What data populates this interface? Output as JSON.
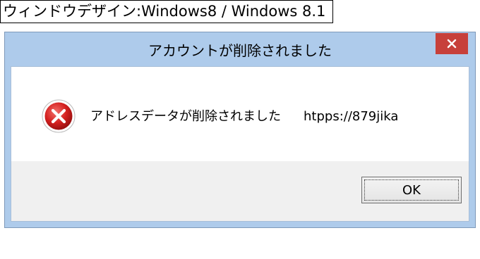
{
  "caption": "ウィンドウデザイン:Windows8 / Windows 8.1",
  "dialog": {
    "title": "アカウントが削除されました",
    "message": "アドレスデータが削除されました",
    "url": "htpps://879jika",
    "ok_label": "OK",
    "close_icon": "close-icon",
    "status_icon": "error-icon"
  },
  "colors": {
    "frame": "#aecbeb",
    "close_button": "#c7403a",
    "error_red": "#d4201f"
  }
}
